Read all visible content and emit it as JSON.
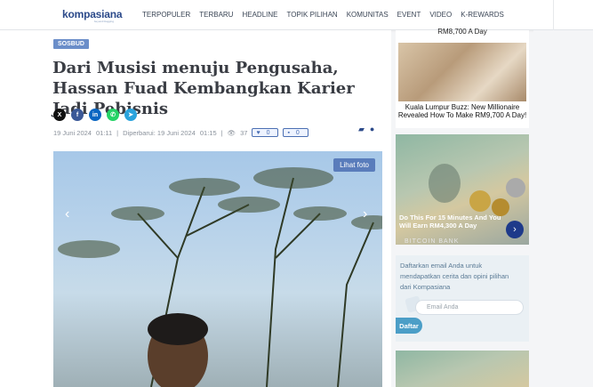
{
  "nav": {
    "logo": "kompasiana",
    "logo_sub": "beyond blogging",
    "items": [
      "TERPOPULER",
      "TERBARU",
      "HEADLINE",
      "TOPIK PILIHAN",
      "KOMUNITAS",
      "EVENT",
      "VIDEO",
      "K-REWARDS"
    ]
  },
  "article": {
    "category": "SOSBUD",
    "title": "Dari Musisi menuju Pengusaha, Hassan Fuad Kembangkan Karier Jadi Pebisnis",
    "date": "19 Juni 2024",
    "time": "01:11",
    "updated_label": "Diperbarui: 19 Juni 2024",
    "updated_time": "01:15",
    "views": "37",
    "likes": "0",
    "comments": "0",
    "photo_button": "Lihat foto"
  },
  "share_icons": [
    "x-icon",
    "facebook-icon",
    "linkedin-icon",
    "whatsapp-icon",
    "telegram-icon"
  ],
  "ads": {
    "ad1_top": "RM8,700 A Day",
    "ad1_caption": "Kuala Lumpur Buzz: New Millionaire Revealed How To Make RM9,700 A Day!",
    "ad2_caption": "Do This For 15 Minutes And You Will Earn RM4,300 A Day",
    "ad2_footer": "BITCOIN BANK"
  },
  "newsletter": {
    "text": "Daftarkan email Anda untuk mendapatkan cerita dan opini pilihan dari Kompasiana",
    "placeholder": "Email Anda",
    "button": "Daftar"
  }
}
